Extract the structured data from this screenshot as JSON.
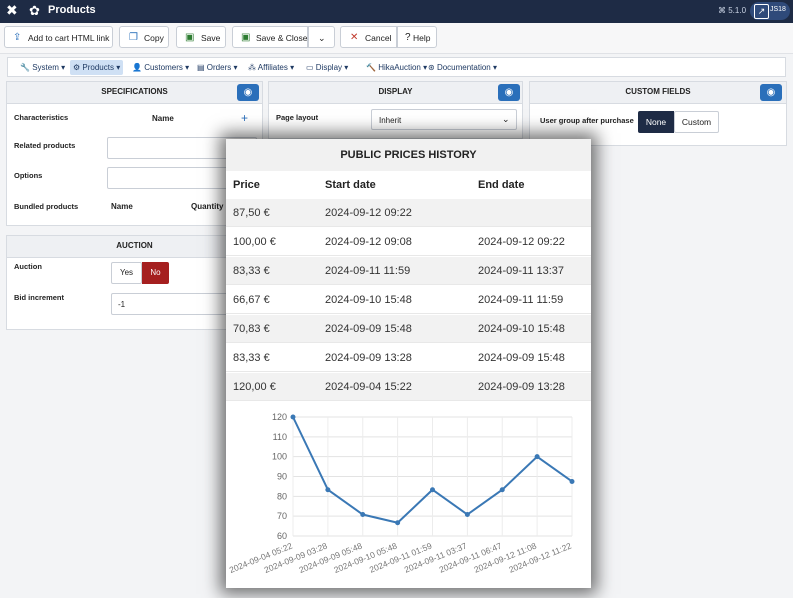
{
  "header": {
    "title": "Products",
    "version": "5.1.0",
    "user": "JS18"
  },
  "toolbar": {
    "add_to_cart": "Add to cart HTML link",
    "copy": "Copy",
    "save": "Save",
    "save_close": "Save & Close",
    "cancel": "Cancel",
    "help": "Help"
  },
  "menu": {
    "items": [
      "System",
      "Products",
      "Customers",
      "Orders",
      "Affiliates",
      "Display",
      "HikaAuction",
      "Documentation"
    ]
  },
  "specifications": {
    "title": "SPECIFICATIONS",
    "characteristics": "Characteristics",
    "name_col": "Name",
    "related_products": "Related products",
    "options": "Options",
    "bundled_products": "Bundled products",
    "bundle_name_col": "Name",
    "bundle_qty_col": "Quantity"
  },
  "auction": {
    "title": "AUCTION",
    "auction_label": "Auction",
    "yes": "Yes",
    "no": "No",
    "bid_increment_label": "Bid increment",
    "bid_increment_value": "-1"
  },
  "display": {
    "title": "DISPLAY",
    "page_layout_label": "Page layout",
    "page_layout_value": "Inherit"
  },
  "custom_fields": {
    "title": "CUSTOM FIELDS",
    "user_group_label": "User group after purchase",
    "none": "None",
    "custom": "Custom"
  },
  "modal": {
    "title": "PUBLIC PRICES HISTORY",
    "columns": [
      "Price",
      "Start date",
      "End date"
    ],
    "rows": [
      {
        "price": "87,50 €",
        "start": "2024-09-12 09:22",
        "end": ""
      },
      {
        "price": "100,00 €",
        "start": "2024-09-12 09:08",
        "end": "2024-09-12 09:22"
      },
      {
        "price": "83,33 €",
        "start": "2024-09-11 11:59",
        "end": "2024-09-11 13:37"
      },
      {
        "price": "66,67 €",
        "start": "2024-09-10 15:48",
        "end": "2024-09-11 11:59"
      },
      {
        "price": "70,83 €",
        "start": "2024-09-09 15:48",
        "end": "2024-09-10 15:48"
      },
      {
        "price": "83,33 €",
        "start": "2024-09-09 13:28",
        "end": "2024-09-09 15:48"
      },
      {
        "price": "120,00 €",
        "start": "2024-09-04 15:22",
        "end": "2024-09-09 13:28"
      }
    ]
  },
  "chart_data": {
    "type": "line",
    "x": [
      "2024-09-04 05:22",
      "2024-09-09 03:28",
      "2024-09-09 05:48",
      "2024-09-10 05:48",
      "2024-09-11 01:59",
      "2024-09-11 03:37",
      "2024-09-11 06:47",
      "2024-09-12 11:08",
      "2024-09-12 11:22"
    ],
    "values": [
      120,
      83.33,
      70.83,
      66.67,
      83.33,
      70.83,
      83.33,
      100,
      87.5
    ],
    "ylim": [
      60,
      120
    ],
    "yticks": [
      60,
      70,
      80,
      90,
      100,
      110,
      120
    ],
    "grid": true,
    "line_color": "#3a78b5"
  }
}
